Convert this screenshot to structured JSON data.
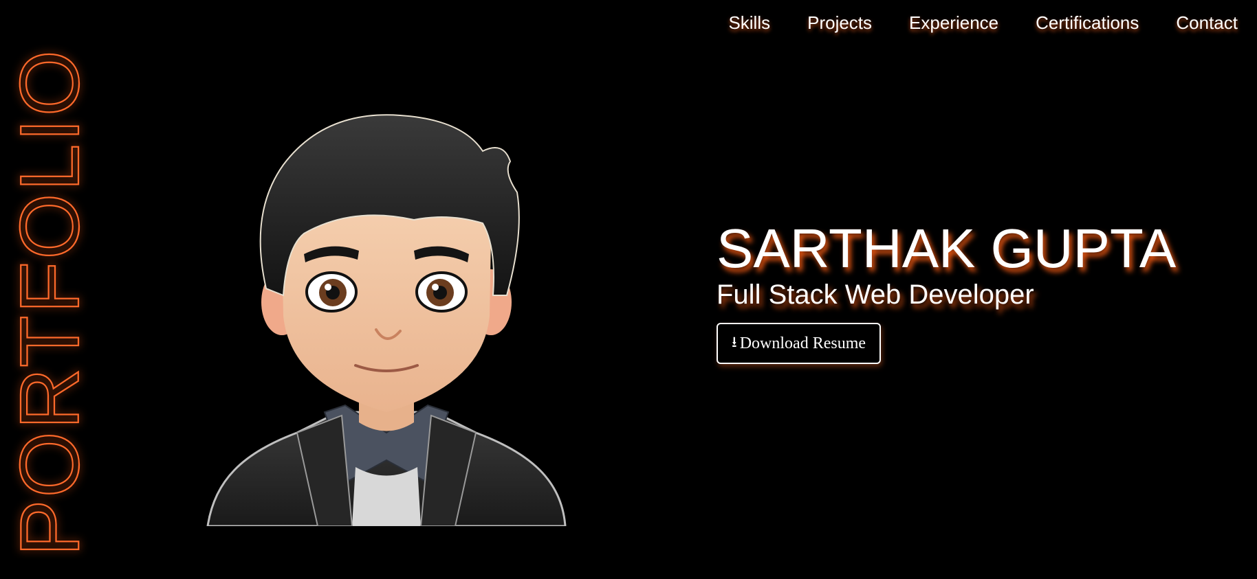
{
  "brand": {
    "vertical_title": "PORTFOLIO",
    "accent_color": "#ff6a2b"
  },
  "nav": {
    "items": [
      {
        "label": "Skills"
      },
      {
        "label": "Projects"
      },
      {
        "label": "Experience"
      },
      {
        "label": "Certifications"
      },
      {
        "label": "Contact"
      }
    ]
  },
  "hero": {
    "name": "SARTHAK GUPTA",
    "role": "Full Stack Web Developer",
    "download_icon": "download-arrow-icon",
    "download_label": "Download Resume"
  },
  "avatar": {
    "icon": "cartoon-avatar-portrait"
  },
  "colors": {
    "background": "#000000",
    "text": "#ffffff",
    "glow": "#ff5f14"
  }
}
